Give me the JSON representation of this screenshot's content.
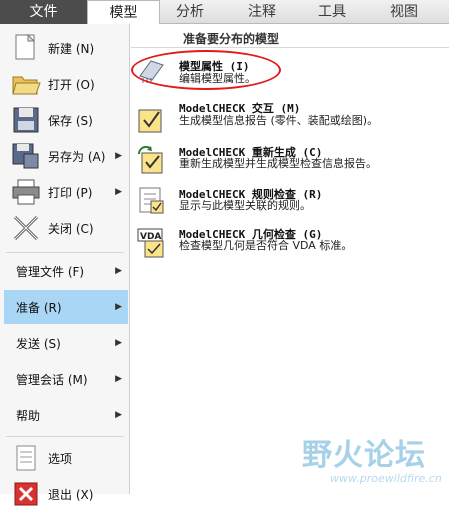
{
  "tabs": [
    {
      "label": "文件",
      "state": "file"
    },
    {
      "label": "模型",
      "state": "active"
    },
    {
      "label": "分析",
      "state": "normal"
    },
    {
      "label": "注释",
      "state": "normal"
    },
    {
      "label": "工具",
      "state": "normal"
    },
    {
      "label": "视图",
      "state": "normal"
    }
  ],
  "left_menu": {
    "icon_items": [
      {
        "label": "新建 (N)",
        "icon": "new-file-icon"
      },
      {
        "label": "打开 (O)",
        "icon": "open-folder-icon"
      },
      {
        "label": "保存 (S)",
        "icon": "save-disk-icon"
      },
      {
        "label": "另存为 (A)",
        "icon": "save-as-icon",
        "submenu": true
      },
      {
        "label": "打印 (P)",
        "icon": "printer-icon",
        "submenu": true
      },
      {
        "label": "关闭 (C)",
        "icon": "close-x-icon"
      }
    ],
    "text_items": [
      {
        "label": "管理文件 (F)",
        "submenu": true
      },
      {
        "label": "准备 (R)",
        "submenu": true,
        "highlighted": true
      },
      {
        "label": "发送 (S)",
        "submenu": true
      },
      {
        "label": "管理会话 (M)",
        "submenu": true
      },
      {
        "label": "帮助",
        "submenu": true
      }
    ],
    "bottom_items": [
      {
        "label": "选项",
        "icon": "options-icon"
      },
      {
        "label": "退出 (X)",
        "icon": "exit-icon"
      }
    ]
  },
  "right_panel": {
    "header": "准备要分布的模型",
    "items": [
      {
        "title": "模型属性 (I)",
        "desc": "编辑模型属性。",
        "icon": "model-properties-icon"
      },
      {
        "title": "ModelCHECK 交互 (M)",
        "desc": "生成模型信息报告 (零件、装配或绘图)。",
        "icon": "modelcheck-interactive-icon"
      },
      {
        "title": "ModelCHECK 重新生成 (C)",
        "desc": "重新生成模型并生成模型检查信息报告。",
        "icon": "modelcheck-regenerate-icon"
      },
      {
        "title": "ModelCHECK 规则检查 (R)",
        "desc": "显示与此模型关联的规则。",
        "icon": "modelcheck-rule-check-icon"
      },
      {
        "title": "ModelCHECK 几何检查 (G)",
        "desc": "检查模型几何是否符合 VDA 标准。",
        "icon": "modelcheck-geometry-check-icon",
        "badge": "VDA"
      }
    ]
  },
  "watermark": {
    "main": "野火论坛",
    "url": "www.proewildfire.cn"
  },
  "colors": {
    "file_tab_bg": "#4c4c4c",
    "highlight_row": "#a9d6f5",
    "annotation_ring": "#e21a1a"
  }
}
